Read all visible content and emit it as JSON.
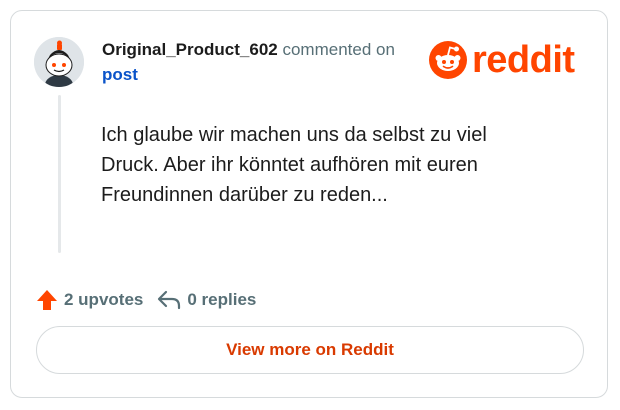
{
  "comment": {
    "author": "Original_Product_602",
    "action_text": " commented on ",
    "target_link": "post",
    "body": "Ich glaube wir machen uns da selbst zu viel Druck. Aber ihr könntet aufhören mit euren Freundinnen darüber zu reden..."
  },
  "brand": {
    "wordmark": "reddit",
    "color": "#ff4500"
  },
  "stats": {
    "upvotes_label": "2 upvotes",
    "replies_label": "0 replies"
  },
  "footer": {
    "view_more_label": "View more on Reddit"
  },
  "icons": {
    "upvote": "upvote-arrow-icon",
    "reply": "reply-arrow-icon",
    "logo": "reddit-snoo-icon",
    "avatar": "snoo-avatar"
  },
  "colors": {
    "accent": "#ff4500",
    "link": "#0a53c9",
    "view_more_text": "#d93a00",
    "muted_text": "#576f76"
  }
}
